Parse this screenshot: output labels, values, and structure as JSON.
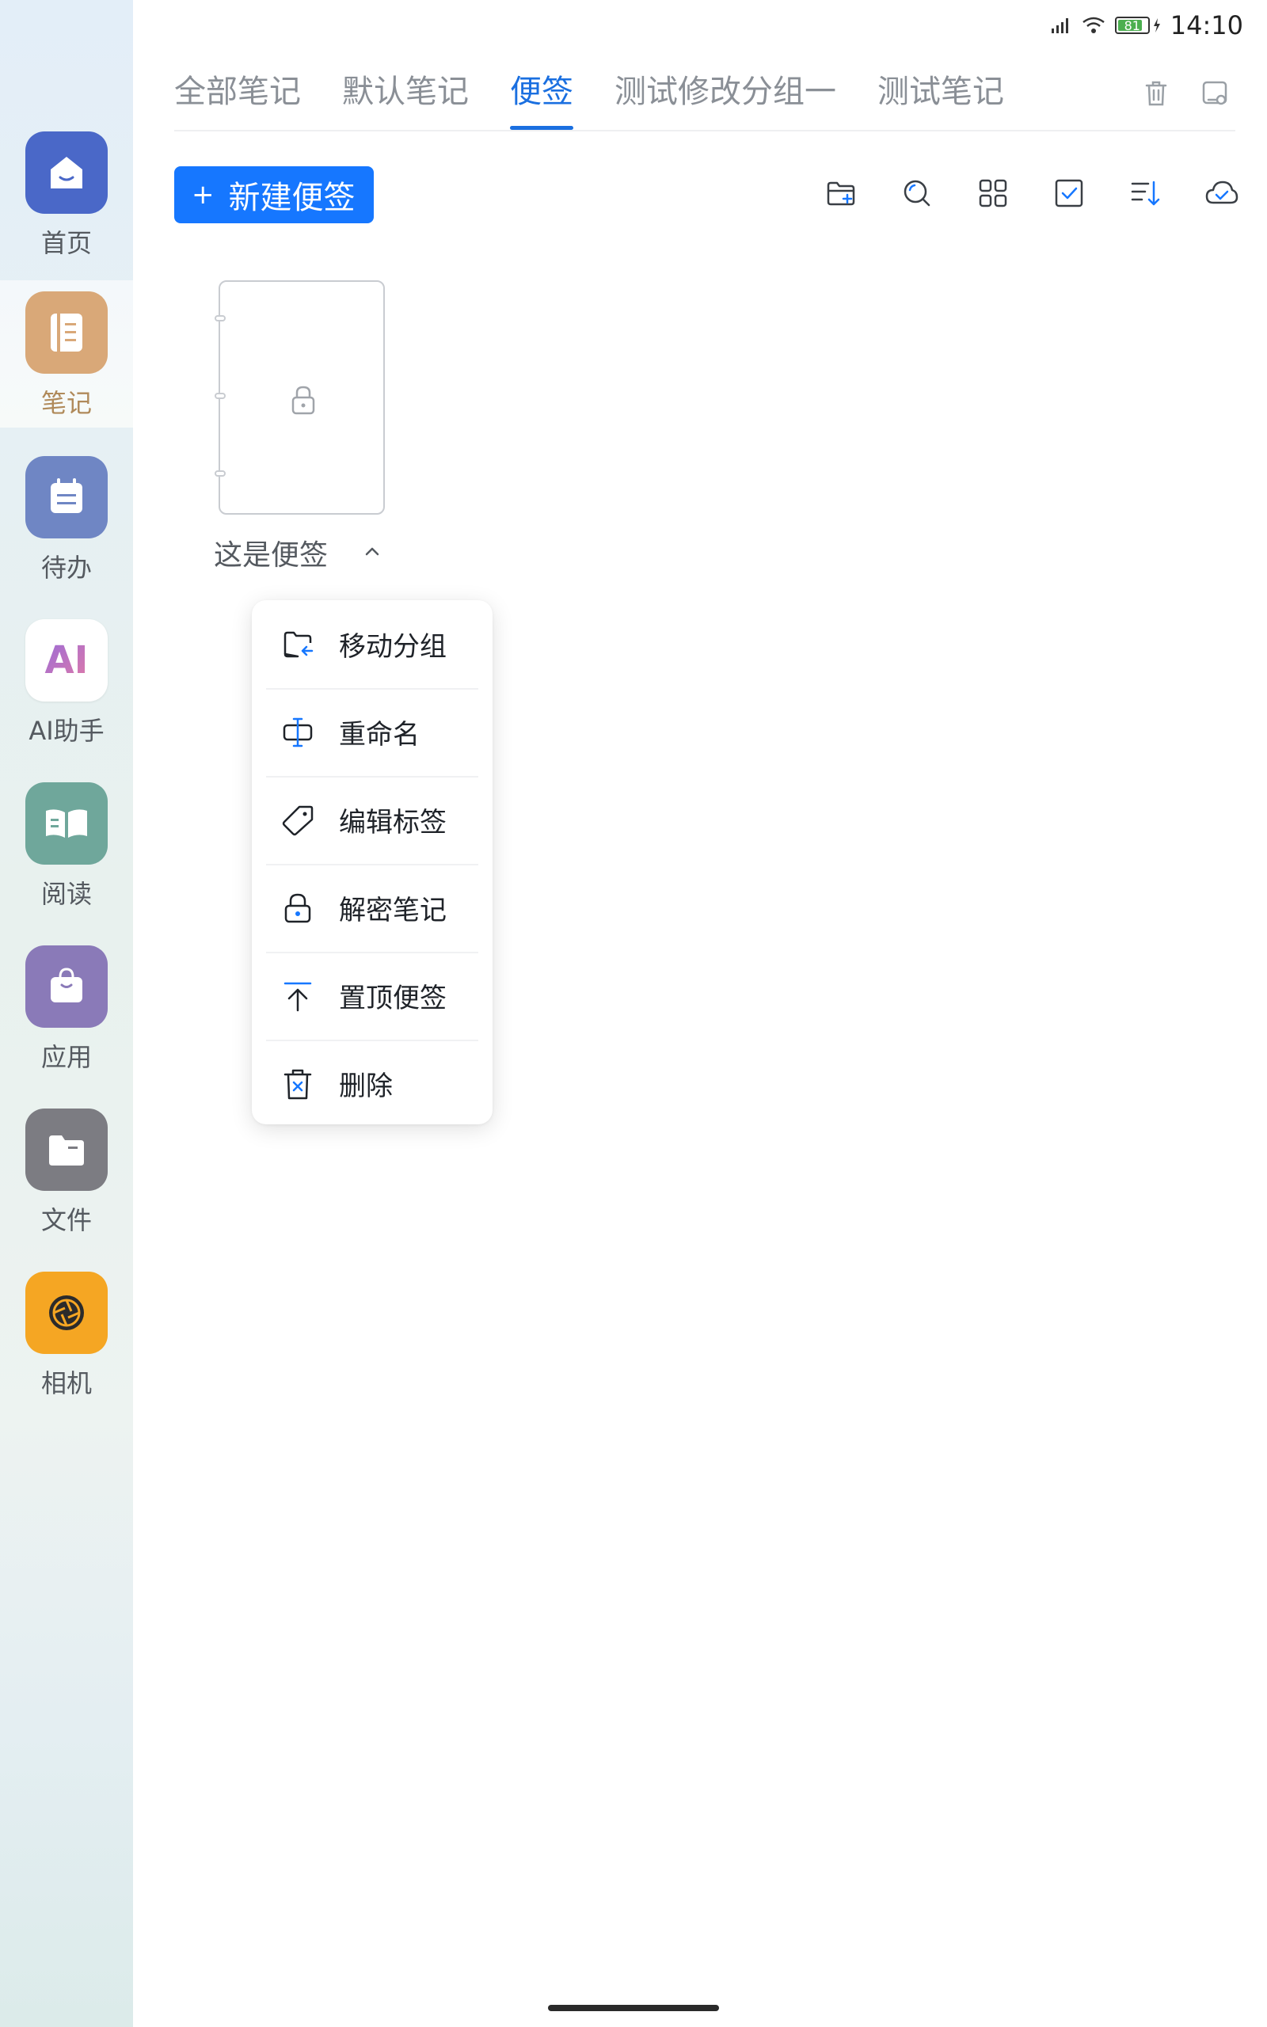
{
  "status_bar": {
    "time": "14:10",
    "battery": "81"
  },
  "rail": {
    "items": [
      {
        "label": "首页",
        "color": "#4a68c8"
      },
      {
        "label": "笔记",
        "color": "#d9a878"
      },
      {
        "label": "待办",
        "color": "#6f86c4"
      },
      {
        "label": "AI助手",
        "color": "#ffffff",
        "glyph": "AI"
      },
      {
        "label": "阅读",
        "color": "#6fa79b"
      },
      {
        "label": "应用",
        "color": "#8a7ab8"
      },
      {
        "label": "文件",
        "color": "#7c7c82"
      },
      {
        "label": "相机",
        "color": "#f5a623"
      }
    ],
    "active_index": 1
  },
  "tabs": [
    {
      "label": "全部笔记"
    },
    {
      "label": "默认笔记"
    },
    {
      "label": "便签"
    },
    {
      "label": "测试修改分组一"
    },
    {
      "label": "测试笔记"
    }
  ],
  "active_tab": 2,
  "new_button": {
    "label": "新建便签"
  },
  "toolbar_icons": [
    "folder-add-icon",
    "search-icon",
    "grid-view-icon",
    "checkbox-select-icon",
    "sort-icon",
    "cloud-sync-icon"
  ],
  "note": {
    "title": "这是便签",
    "locked": true
  },
  "context_menu": {
    "items": [
      {
        "label": "移动分组",
        "icon": "move-folder-icon"
      },
      {
        "label": "重命名",
        "icon": "rename-icon"
      },
      {
        "label": "编辑标签",
        "icon": "tag-icon"
      },
      {
        "label": "解密笔记",
        "icon": "lock-icon"
      },
      {
        "label": "置顶便签",
        "icon": "pin-top-icon"
      },
      {
        "label": "删除",
        "icon": "delete-icon"
      }
    ]
  },
  "colors": {
    "accent": "#1677ff",
    "active_tab": "#1a6fe0",
    "notes_label_active": "#b08a5a"
  }
}
